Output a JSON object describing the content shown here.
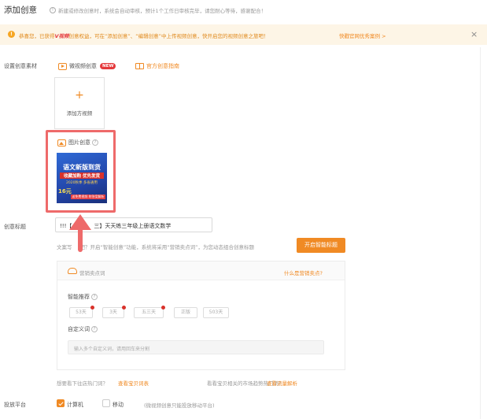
{
  "header": {
    "title": "添加创意",
    "subtitle": "新建或修改创意时，系统会自动审核，预计1个工作日审核完毕，请您耐心等待，感谢配合！"
  },
  "notice": {
    "message_prefix": "恭喜您，已获得",
    "badge": "V视频",
    "message_suffix": "创意权益，可在“添加创意”、“编辑创意”中上传视频创意，快开启您的视频创意之旅吧！",
    "link": "快戳官网优秀案例 >",
    "close": "×"
  },
  "creative_material": {
    "label": "设置创意素材",
    "video_tab": "微视频创意",
    "new_badge": "NEW",
    "guide_link": "官方创意指南",
    "add_video_plus": "+",
    "add_video_label": "添加方视频",
    "image_tab": "图片创意",
    "image_help": "?",
    "thumbnail": {
      "line1": "语文新版到货",
      "line2": "收藏加购 优先发货",
      "line3": "2020秋季 多省通用",
      "line4": "16元",
      "line5": "送免费视频 附答案解析"
    }
  },
  "creative_title": {
    "label": "创意标题",
    "value": "!!!【",
    "value_rest": "三】天天练三年级上册语文数学",
    "tip": "文案写",
    "tip_rest": "吧？开启“智能创意”功能，系统将采用“营销卖点词”，为您动态组合创意标题",
    "smart_button": "开启智能标题"
  },
  "selling_points": {
    "header_label": "营销卖点词",
    "what_link": "什么是营销卖点?",
    "recommend_label": "智能推荐",
    "chips": [
      "53天",
      "3天",
      "五三天",
      "正版",
      "503天"
    ],
    "custom_label": "自定义词",
    "custom_placeholder": "输入多个自定义词，请用回车来分割"
  },
  "hot_queries": {
    "q1": "想要看下往店热门词？",
    "q1_link": "查看宝贝词表",
    "q2": "看看宝贝相关的市场趋势热门词？",
    "q2_link": "查看流量解析"
  },
  "platform": {
    "label": "投放平台",
    "options": [
      {
        "label": "计算机",
        "checked": true
      },
      {
        "label": "移动",
        "checked": false
      }
    ],
    "note": "(微视频创意只能投放移动平台)"
  },
  "colors": {
    "accent": "#f08a24",
    "highlight": "#ee6a6a",
    "notice_bg": "#fdf5e6"
  }
}
